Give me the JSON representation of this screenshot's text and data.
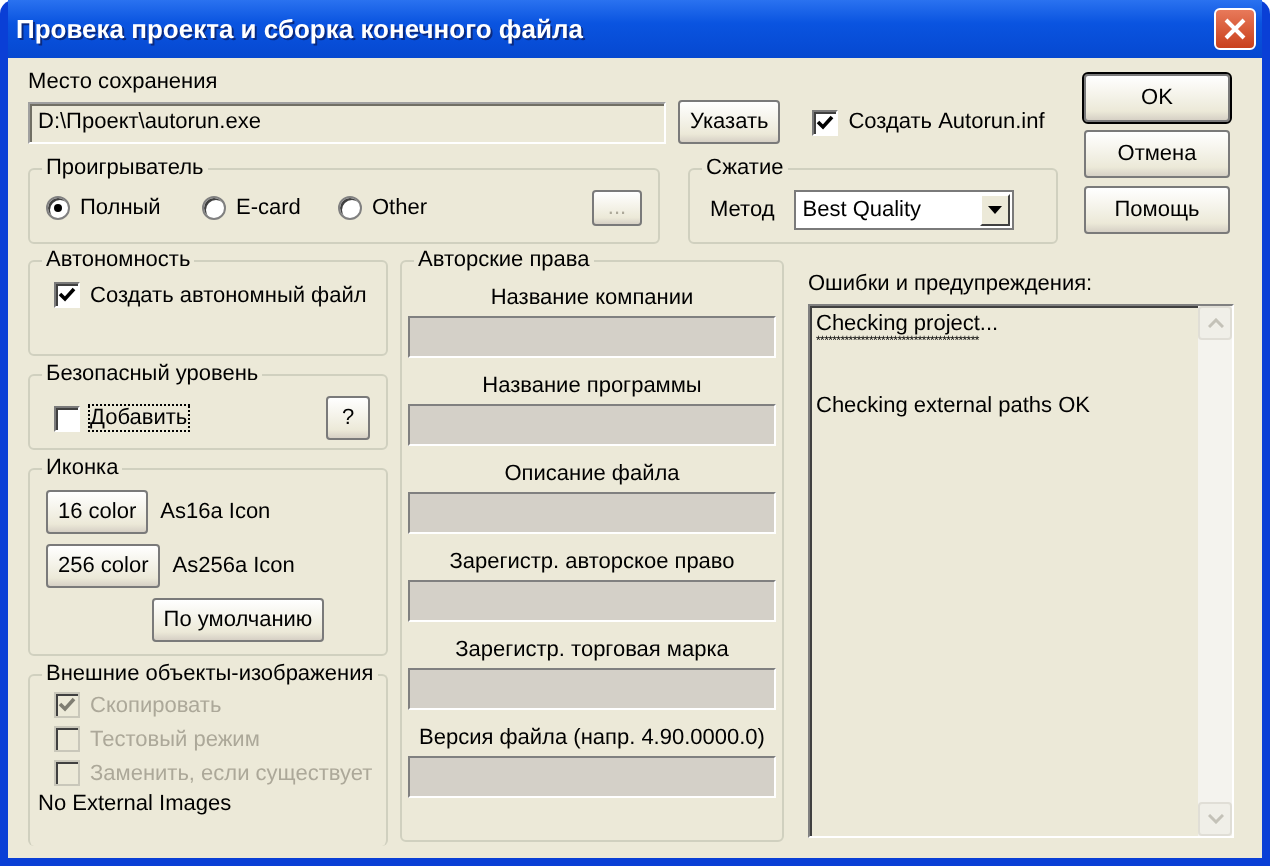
{
  "window": {
    "title": "Провека проекта и сборка конечного файла"
  },
  "save_location": {
    "label": "Место сохранения",
    "value": "D:\\Проект\\autorun.exe",
    "browse_button": "Указать"
  },
  "autorun": {
    "label": "Создать Autorun.inf",
    "checked": true
  },
  "dialog_buttons": [
    {
      "label": "OK",
      "default": true
    },
    {
      "label": "Отмена",
      "default": false
    },
    {
      "label": "Помощь",
      "default": false
    }
  ],
  "player": {
    "title": "Проигрыватель",
    "options": [
      {
        "label": "Полный",
        "selected": true
      },
      {
        "label": "E-card",
        "selected": false
      },
      {
        "label": "Other",
        "selected": false
      }
    ],
    "more_button": {
      "label": "...",
      "disabled": true
    }
  },
  "compression": {
    "title": "Сжатие",
    "method_label": "Метод",
    "method": "Best Quality"
  },
  "autonomy": {
    "title": "Автономность",
    "checkbox": {
      "label": "Создать автономный файл",
      "checked": true
    }
  },
  "safety": {
    "title": "Безопасный уровень",
    "checkbox": {
      "label": "Добавить",
      "checked": false,
      "focused": true
    },
    "help_button": "?"
  },
  "icon": {
    "title": "Иконка",
    "rows": [
      {
        "button": "16 color",
        "name": "As16a Icon"
      },
      {
        "button": "256 color",
        "name": "As256a Icon"
      }
    ],
    "default_button": "По умолчанию"
  },
  "external_images": {
    "title": "Внешние объекты-изображения",
    "options": [
      {
        "label": "Скопировать",
        "checked": true,
        "disabled": true
      },
      {
        "label": "Тестовый режим",
        "checked": false,
        "disabled": true
      },
      {
        "label": "Заменить, если существует",
        "checked": false,
        "disabled": true
      }
    ],
    "status": "No External Images"
  },
  "copyright": {
    "title": "Авторские права",
    "fields": [
      {
        "label": "Название компании",
        "disabled": true
      },
      {
        "label": "Название программы",
        "disabled": true
      },
      {
        "label": "Описание файла",
        "disabled": true
      },
      {
        "label": "Зарегистр. авторское право",
        "disabled": true
      },
      {
        "label": "Зарегистр. торговая марка",
        "disabled": true
      },
      {
        "label": "Версия файла (напр. 4.90.0000.0)",
        "disabled": true
      }
    ]
  },
  "messages": {
    "label": "Ошибки и предупреждения:",
    "lines": [
      {
        "kind": "text",
        "text": "Checking project..."
      },
      {
        "kind": "rule",
        "text": "****************************************"
      },
      {
        "kind": "text",
        "text": "Checking external paths OK"
      }
    ]
  }
}
